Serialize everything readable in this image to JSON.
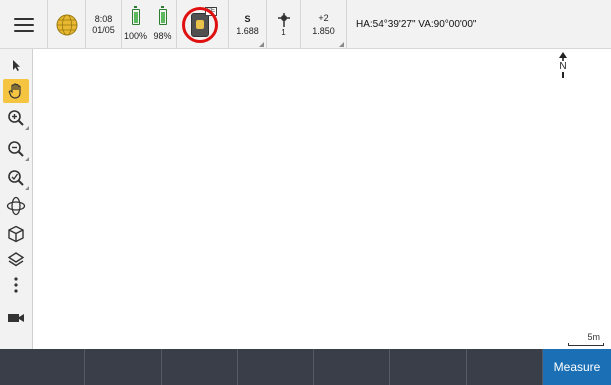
{
  "status_bar": {
    "menu_icon": "hamburger-menu-icon",
    "globe_icon": "globe-icon",
    "time": "8:08",
    "date": "01/05",
    "battery_1": {
      "level_percent": 100,
      "label": "100%",
      "icon": "battery-icon"
    },
    "battery_2": {
      "level_percent": 98,
      "label": "98%",
      "icon": "battery-icon"
    },
    "instrument": {
      "icon": "total-station-icon",
      "badge": "SE",
      "highlight_color": "#e01010"
    },
    "s_value": {
      "label": "S",
      "value": "1.688"
    },
    "target": {
      "icon": "prism-target-icon",
      "label": "1"
    },
    "height": {
      "label": "+2",
      "value": "1.850"
    },
    "angles": "HA:54°39'27\"  VA:90°00'00\""
  },
  "toolbar": {
    "items": [
      {
        "name": "select-tool",
        "icon": "pointer-icon",
        "active": false
      },
      {
        "name": "pan-tool",
        "icon": "hand-icon",
        "active": true
      },
      {
        "name": "zoom-in-tool",
        "icon": "zoom-in-icon",
        "active": false
      },
      {
        "name": "zoom-out-tool",
        "icon": "zoom-out-icon",
        "active": false
      },
      {
        "name": "zoom-extents-tool",
        "icon": "zoom-extents-icon",
        "active": false
      },
      {
        "name": "orbit-tool",
        "icon": "orbit-icon",
        "active": false
      },
      {
        "name": "view-cube-tool",
        "icon": "cube-icon",
        "active": false
      },
      {
        "name": "layers-tool",
        "icon": "layers-icon",
        "active": false
      },
      {
        "name": "more-tool",
        "icon": "more-vertical-icon",
        "active": false
      },
      {
        "name": "camera-tool",
        "icon": "video-camera-icon",
        "active": false
      }
    ],
    "active_color": "#f5c542"
  },
  "map": {
    "north_label": "N",
    "scale_label": "5m"
  },
  "softkeys": {
    "items": [
      "",
      "",
      "",
      "",
      "",
      "",
      "",
      "Measure"
    ],
    "primary_color": "#1a6fb5"
  }
}
